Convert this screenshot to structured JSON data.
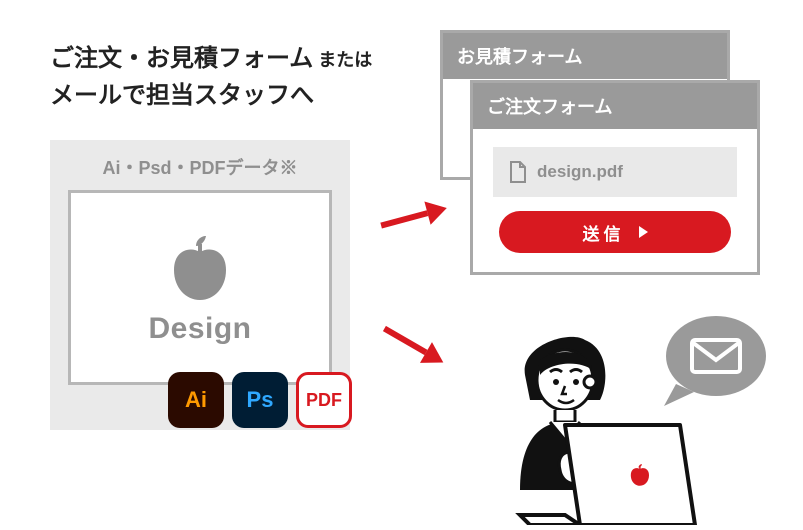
{
  "headline": {
    "line1_strong": "ご注文・お見積フォーム",
    "line1_sub": " または",
    "line2": "メールで担当スタッフへ"
  },
  "design_panel": {
    "title": "Ai・Psd・PDFデータ※",
    "card_label": "Design"
  },
  "file_badges": {
    "ai": "Ai",
    "ps": "Ps",
    "pdf": "PDF"
  },
  "forms": {
    "back_title": "お見積フォーム",
    "front_title": "ご注文フォーム",
    "file_name": "design.pdf",
    "submit_label": "送信"
  },
  "colors": {
    "accent_red": "#d81920",
    "gray_fill": "#9a9a9a",
    "gray_text": "#8f8f8f",
    "panel_bg": "#eaeaea"
  }
}
